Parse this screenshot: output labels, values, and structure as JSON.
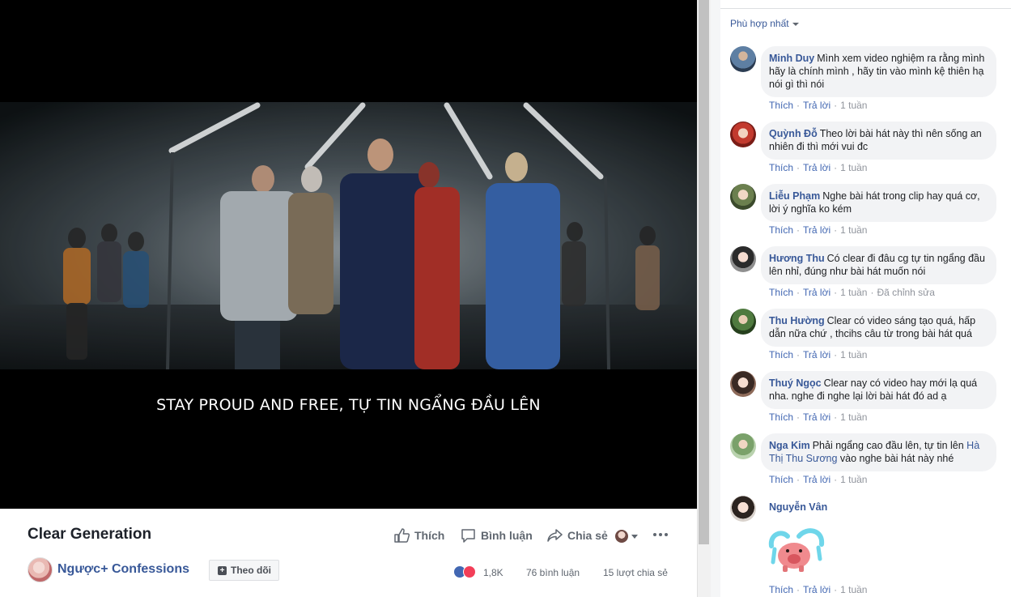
{
  "video": {
    "subtitle": "STAY PROUD AND FREE, TỰ TIN NGẨNG ĐẦU LÊN"
  },
  "info": {
    "title": "Clear Generation",
    "like_label": "Thích",
    "comment_label": "Bình luận",
    "share_label": "Chia sẻ",
    "page_name": "Ngược+ Confessions",
    "follow_label": "Theo dõi",
    "reactions_count": "1,8K",
    "comments_count": "76 bình luận",
    "shares_count": "15 lượt chia sẻ",
    "colors": {
      "like_blue": "#4267b2",
      "love_red": "#f33e58"
    }
  },
  "comments_pane": {
    "sort_label": "Phù hợp nhất",
    "like_label": "Thích",
    "reply_label": "Trả lời",
    "comments": [
      {
        "author": "Minh Duy",
        "text": "Mình xem video nghiệm ra rằng mình hãy là chính mình , hãy tin vào mình kệ thiên hạ nói gì thì nói",
        "time": "1 tuần"
      },
      {
        "author": "Quỳnh Đỗ",
        "text": "Theo lời bài hát này thì nên sống an nhiên đi thì mới vui đc",
        "time": "1 tuần"
      },
      {
        "author": "Liễu Phạm",
        "text": "Nghe bài hát trong clip hay quá cơ, lời ý nghĩa ko kém",
        "time": "1 tuần"
      },
      {
        "author": "Hương Thu",
        "text": "Có clear đi đâu cg tự tin ngẩng đầu lên nhỉ, đúng như bài hát muốn nói",
        "time": "1 tuần",
        "edited": "Đã chỉnh sửa"
      },
      {
        "author": "Thu Hường",
        "text": "Clear có video sáng tạo quá, hấp dẫn nữa chứ , thcihs câu từ trong bài hát quá",
        "time": "1 tuần"
      },
      {
        "author": "Thuý Ngọc",
        "text": "Clear nay có video hay mới lạ quá nha. nghe đi nghe lại lời bài hát đó ad ạ",
        "time": "1 tuần"
      },
      {
        "author": "Nga Kim",
        "text_before": "Phải ngẩng cao đầu lên, tự tin lên",
        "mention": "Hà Thị Thu Sương",
        "text_after": "vào nghe bài hát này nhé",
        "time": "1 tuần"
      },
      {
        "author": "Nguyễn Vân",
        "time": "1 tuần"
      }
    ]
  }
}
